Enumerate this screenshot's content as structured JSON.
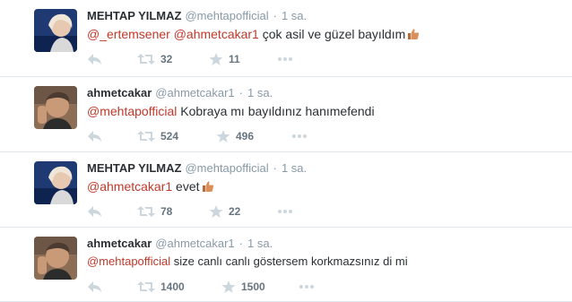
{
  "tweets": [
    {
      "author": "MEHTAP YILMAZ",
      "handle": "@mehtapofficial",
      "separator": "·",
      "time": "1 sa.",
      "mentions": [
        "@_ertemsener",
        "@ahmetcakar1"
      ],
      "text": "çok asil ve güzel bayıldım",
      "retweets": "32",
      "favorites": "11",
      "avatar": "mehtap"
    },
    {
      "author": "ahmetcakar",
      "handle": "@ahmetcakar1",
      "separator": "·",
      "time": "1 sa.",
      "mentions": [
        "@mehtapofficial"
      ],
      "text": "Kobraya mı bayıldınız hanımefendi",
      "retweets": "524",
      "favorites": "496",
      "avatar": "ahmet"
    },
    {
      "author": "MEHTAP YILMAZ",
      "handle": "@mehtapofficial",
      "separator": "·",
      "time": "1 sa.",
      "mentions": [
        "@ahmetcakar1"
      ],
      "text": "evet",
      "retweets": "78",
      "favorites": "22",
      "avatar": "mehtap"
    },
    {
      "author": "ahmetcakar",
      "handle": "@ahmetcakar1",
      "separator": "·",
      "time": "1 sa.",
      "mentions": [
        "@mehtapofficial"
      ],
      "text": "size canlı canlı göstersem korkmazsınız di mi",
      "retweets": "1400",
      "favorites": "1500",
      "avatar": "ahmet"
    }
  ],
  "colors": {
    "mention": "#c0392b",
    "meta": "#8899a6",
    "divider": "#e1e8ed"
  },
  "icons": [
    "reply-icon",
    "retweet-icon",
    "favorite-star-icon",
    "more-dots-icon",
    "thumbs-up-emoji"
  ]
}
